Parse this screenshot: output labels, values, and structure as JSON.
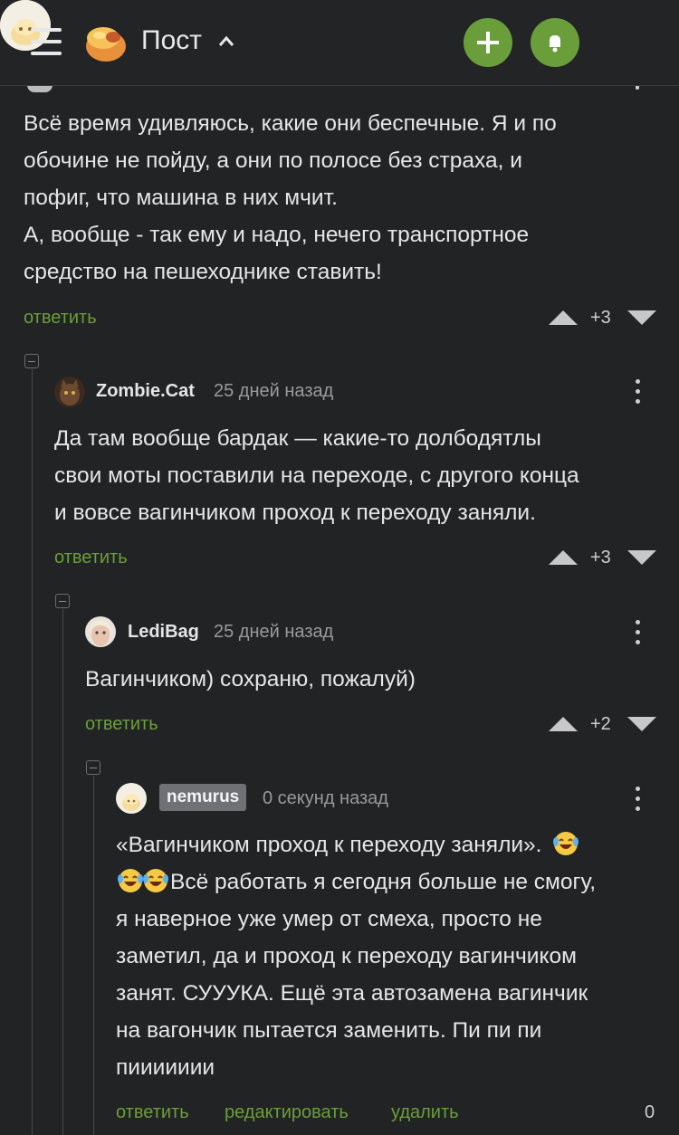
{
  "header": {
    "title": "Пост",
    "menu_icon": "hamburger-icon",
    "logo_icon": "site-logo-icon",
    "add_icon": "plus-icon",
    "bell_icon": "bell-icon",
    "accent_color": "#6a9e3a"
  },
  "comments": [
    {
      "text_lines": [
        "Всё время удивляюсь, какие они беспечные. Я и по",
        "обочине не пойду, а они по полосе без страха, и",
        "пофиг, что машина в них мчит.",
        "А, вообще - так ему и надо, нечего транспортное",
        "средство на пешеходнике ставить!"
      ],
      "reply_label": "ответить",
      "score": "+3"
    },
    {
      "username": "Zombie.Cat",
      "time": "25 дней назад",
      "text_lines": [
        "Да там вообще бардак — какие-то долбодятлы",
        "свои моты поставили на переходе, с другого конца",
        "и вовсе вагинчиком проход к переходу заняли."
      ],
      "reply_label": "ответить",
      "score": "+3"
    },
    {
      "username": "LediBag",
      "time": "25 дней назад",
      "text_lines": [
        "Вагинчиком) сохраню, пожалуй)"
      ],
      "reply_label": "ответить",
      "score": "+2"
    },
    {
      "username": "nemurus",
      "time": "0 секунд назад",
      "line1": "«Вагинчиком проход к переходу заняли».",
      "line2": "Всё работать я сегодня больше не смогу,",
      "text_lines": [
        "я наверное уже умер от смеха, просто не",
        "заметил, да и проход к переходу вагинчиком",
        "занят. СУУУКА. Ещё эта автозамена вагинчик",
        "на вагончик пытается заменить. Пи пи пи",
        "пиииииии"
      ],
      "reply_label": "ответить",
      "edit_label": "редактировать",
      "delete_label": "удалить",
      "score": "0",
      "emoji_icon": "laughing-emoji-icon"
    }
  ]
}
